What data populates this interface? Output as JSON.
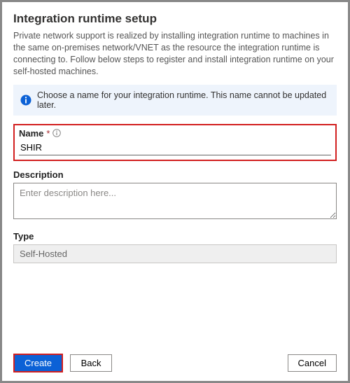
{
  "title": "Integration runtime setup",
  "intro": "Private network support is realized by installing integration runtime to machines in the same on-premises network/VNET as the resource the integration runtime is connecting to. Follow below steps to register and install integration runtime on your self-hosted machines.",
  "info_message": "Choose a name for your integration runtime. This name cannot be updated later.",
  "name": {
    "label": "Name",
    "required_marker": "*",
    "value": "SHIR"
  },
  "description": {
    "label": "Description",
    "placeholder": "Enter description here...",
    "value": ""
  },
  "type": {
    "label": "Type",
    "value": "Self-Hosted"
  },
  "buttons": {
    "create": "Create",
    "back": "Back",
    "cancel": "Cancel"
  }
}
